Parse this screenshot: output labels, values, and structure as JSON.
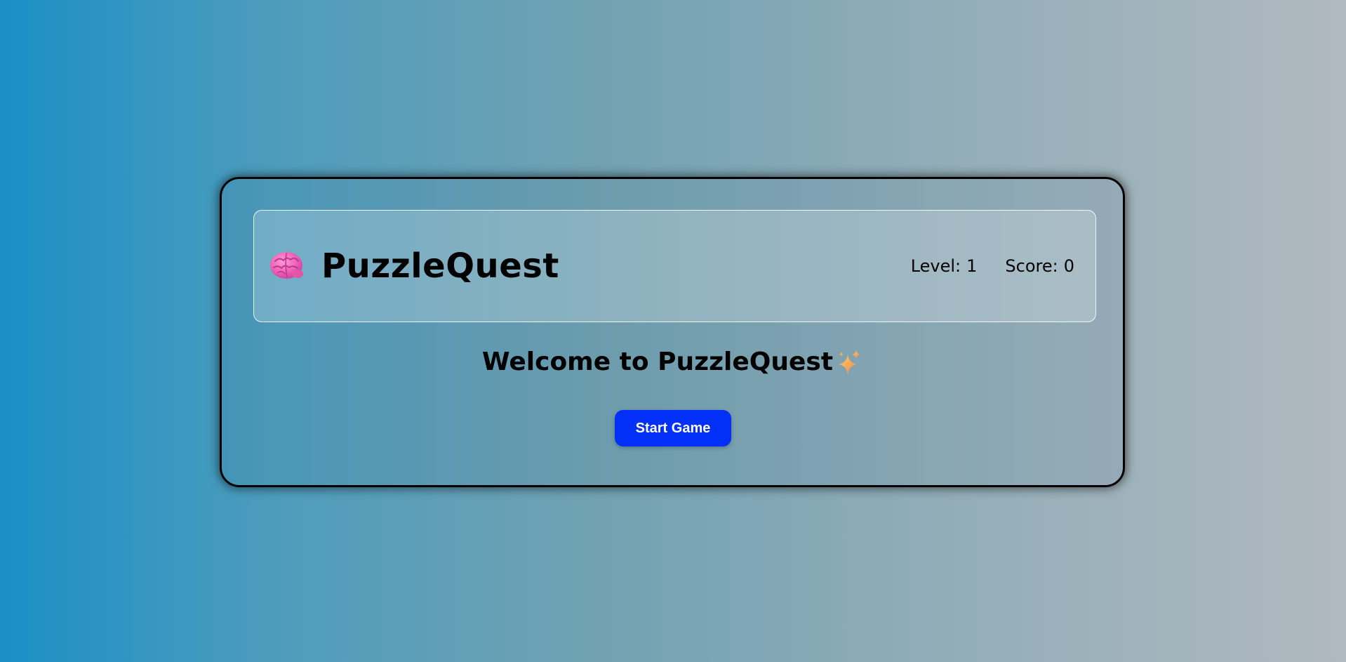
{
  "header": {
    "brand_icon": "brain-icon",
    "title": "PuzzleQuest",
    "level_label": "Level:",
    "level_value": "1",
    "score_label": "Score:",
    "score_value": "0"
  },
  "main": {
    "welcome_text": "Welcome to PuzzleQuest",
    "welcome_icon": "sparkle-icon",
    "start_button_label": "Start Game"
  },
  "colors": {
    "button_bg": "#0230f8",
    "button_text": "#ffffff",
    "brain": "#f060b8",
    "sparkle": "#f5a04a"
  }
}
